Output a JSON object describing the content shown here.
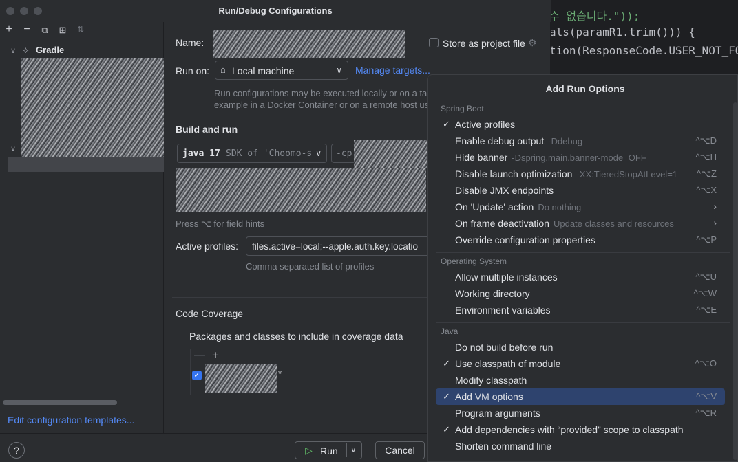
{
  "editor": {
    "lines": [
      "수 없습니다.\"));",
      "als(paramR1.trim())) {",
      "tion(ResponseCode.USER_NOT_FOU"
    ]
  },
  "dialog": {
    "title": "Run/Debug Configurations",
    "toolbar": [
      "add-icon",
      "remove-icon",
      "copy-icon",
      "new-folder-icon",
      "sort-icon"
    ],
    "tree": {
      "gradle_label": "Gradle"
    },
    "edit_templates": "Edit configuration templates...",
    "name_label": "Name:",
    "store_label": "Store as project file",
    "run_on_label": "Run on:",
    "run_on_value": "Local machine",
    "manage_targets": "Manage targets...",
    "run_on_hint": "Run configurations may be executed locally or on a tar\nexample in a Docker Container or on a remote host usi",
    "build_and_run": "Build and run",
    "jdk_strong": "java 17",
    "jdk_rest": "SDK of 'Choomo-s",
    "cp_label": "-cp",
    "field_hint": "Press ⌥ for field hints",
    "active_profiles_label": "Active profiles:",
    "active_profiles_value": "files.active=local;--apple.auth.key.locatio",
    "profiles_hint": "Comma separated list of profiles",
    "code_coverage": "Code Coverage",
    "packages_label": "Packages and classes to include in coverage data",
    "coverage_item_suffix": "*",
    "run_label": "Run",
    "cancel_label": "Cancel",
    "help_label": "?"
  },
  "popup": {
    "title": "Add Run Options",
    "groups": [
      {
        "name": "Spring Boot",
        "items": [
          {
            "label": "Active profiles",
            "hint": "",
            "shortcut": "",
            "checked": true
          },
          {
            "label": "Enable debug output",
            "hint": "-Ddebug",
            "shortcut": "^⌥D",
            "checked": false
          },
          {
            "label": "Hide banner",
            "hint": "-Dspring.main.banner-mode=OFF",
            "shortcut": "^⌥H",
            "checked": false
          },
          {
            "label": "Disable launch optimization",
            "hint": "-XX:TieredStopAtLevel=1",
            "shortcut": "^⌥Z",
            "checked": false
          },
          {
            "label": "Disable JMX endpoints",
            "hint": "",
            "shortcut": "^⌥X",
            "checked": false
          },
          {
            "label": "On 'Update' action",
            "hint": "Do nothing",
            "shortcut": "",
            "submenu": true,
            "checked": false
          },
          {
            "label": "On frame deactivation",
            "hint": "Update classes and resources",
            "shortcut": "",
            "submenu": true,
            "checked": false
          },
          {
            "label": "Override configuration properties",
            "hint": "",
            "shortcut": "^⌥P",
            "checked": false
          }
        ]
      },
      {
        "name": "Operating System",
        "items": [
          {
            "label": "Allow multiple instances",
            "hint": "",
            "shortcut": "^⌥U",
            "checked": false
          },
          {
            "label": "Working directory",
            "hint": "",
            "shortcut": "^⌥W",
            "checked": false
          },
          {
            "label": "Environment variables",
            "hint": "",
            "shortcut": "^⌥E",
            "checked": false
          }
        ]
      },
      {
        "name": "Java",
        "items": [
          {
            "label": "Do not build before run",
            "hint": "",
            "shortcut": "",
            "checked": false
          },
          {
            "label": "Use classpath of module",
            "hint": "",
            "shortcut": "^⌥O",
            "checked": true
          },
          {
            "label": "Modify classpath",
            "hint": "",
            "shortcut": "",
            "checked": false
          },
          {
            "label": "Add VM options",
            "hint": "",
            "shortcut": "^⌥V",
            "checked": true,
            "selected": true
          },
          {
            "label": "Program arguments",
            "hint": "",
            "shortcut": "^⌥R",
            "checked": false
          },
          {
            "label": "Add dependencies with “provided” scope to classpath",
            "hint": "",
            "shortcut": "",
            "checked": true
          },
          {
            "label": "Shorten command line",
            "hint": "",
            "shortcut": "",
            "checked": false
          }
        ]
      }
    ]
  }
}
